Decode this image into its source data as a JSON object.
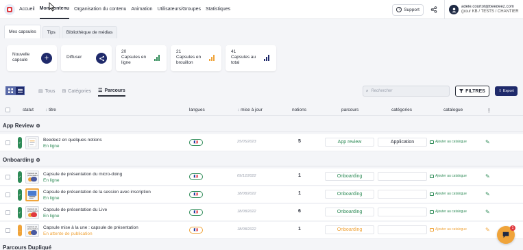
{
  "nav": {
    "items": [
      "Accueil",
      "Mon contenu",
      "Organisation du contenu",
      "Animation",
      "Utilisateurs/Groupes",
      "Statistiques"
    ],
    "support_label": "Support"
  },
  "user": {
    "email": "adele.courtot@beedeez.com",
    "org": "(pour KB / TESTS / CHANTIER"
  },
  "tabs": [
    "Mes capsules",
    "Tips",
    "Bibliothèque de médias"
  ],
  "cards": {
    "new": [
      "Nouvelle",
      "capsule"
    ],
    "diffuser": "Diffuser",
    "online": {
      "count": "20",
      "line1": "Capsules en",
      "line2": "ligne",
      "color": "#2e8b57"
    },
    "draft": {
      "count": "21",
      "line1": "Capsules en",
      "line2": "brouillon",
      "color": "#f0a43a"
    },
    "total": {
      "count": "41",
      "line1": "Capsules au",
      "line2": "total",
      "color": "#1f2a6b"
    }
  },
  "toolbar": {
    "filters": [
      "Tous",
      "Catégories",
      "Parcours"
    ],
    "search_placeholder": "Rechercher",
    "filtres_label": "FILTRES",
    "export_label": "Export"
  },
  "columns": {
    "statut": "statut",
    "titre": "titre",
    "langues": "langues",
    "mise_a_jour": "mise à jour",
    "notions": "notions",
    "parcours": "parcours",
    "categories": "catégories",
    "catalogue": "catalogue"
  },
  "groups": [
    {
      "name": "App Review",
      "rows": [
        {
          "title": "Beedeez en quelques notions",
          "state": "En ligne",
          "date": "25/05/2023",
          "notions": "5",
          "parcours": "App review",
          "categorie": "Application",
          "catalogue": "Ajouter au catalogue",
          "status": "online"
        }
      ]
    },
    {
      "name": "Onboarding",
      "rows": [
        {
          "title": "Capsule de présentation du micro-doing",
          "state": "En ligne",
          "date": "09/12/2022",
          "notions": "1",
          "parcours": "Onboarding",
          "categorie": "",
          "catalogue": "Ajouter au catalogue",
          "status": "online"
        },
        {
          "title": "Capsule de présentation de la session avec inscription",
          "state": "En ligne",
          "date": "18/08/2022",
          "notions": "1",
          "parcours": "Onboarding",
          "categorie": "",
          "catalogue": "Ajouter au catalogue",
          "status": "online"
        },
        {
          "title": "Capsule de présentation du Live",
          "state": "En ligne",
          "date": "18/08/2022",
          "notions": "6",
          "parcours": "Onboarding",
          "categorie": "",
          "catalogue": "Ajouter au catalogue",
          "status": "online"
        },
        {
          "title": "Capsule mise à la une : capsule de présentation",
          "state": "En attente de publication",
          "date": "18/08/2022",
          "notions": "1",
          "parcours": "Onboarding",
          "categorie": "",
          "catalogue": "Ajouter au catalogue",
          "status": "pending"
        }
      ]
    },
    {
      "name": "Parcours Dupliqué",
      "rows": []
    }
  ],
  "thumb_text": "Capsule de présentation",
  "chat_badge": "1",
  "colors": {
    "online": "#2e8b57",
    "pending": "#f0a43a",
    "primary": "#1f2a6b"
  }
}
